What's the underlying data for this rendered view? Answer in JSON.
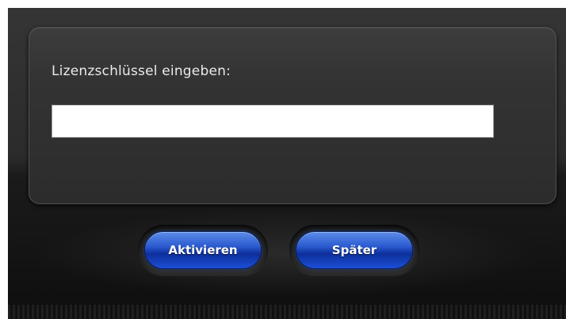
{
  "dialog": {
    "prompt": "Lizenzschlüssel eingeben:",
    "license_value": "",
    "license_placeholder": ""
  },
  "buttons": {
    "activate_label": "Aktivieren",
    "later_label": "Später"
  },
  "colors": {
    "button_blue": "#1c4fd6",
    "background_dark": "#1b1b1b",
    "panel": "#333333"
  }
}
